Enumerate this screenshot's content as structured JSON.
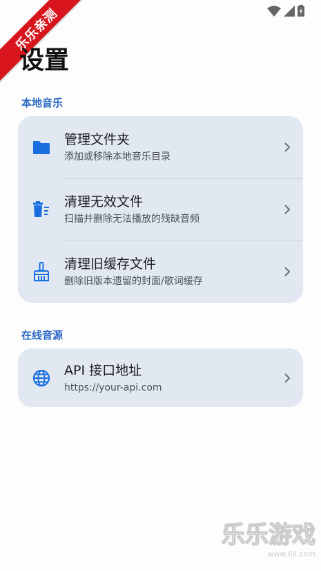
{
  "watermark": {
    "banner_text": "乐乐亲测",
    "bottom_text": "乐乐游戏",
    "bottom_url": "www.6ll.com"
  },
  "page": {
    "title": "设置"
  },
  "sections": [
    {
      "label": "本地音乐",
      "items": [
        {
          "icon": "folder-icon",
          "title": "管理文件夹",
          "subtitle": "添加或移除本地音乐目录"
        },
        {
          "icon": "trash-list-icon",
          "title": "清理无效文件",
          "subtitle": "扫描并删除无法播放的残缺音频"
        },
        {
          "icon": "broom-icon",
          "title": "清理旧缓存文件",
          "subtitle": "删除旧版本遗留的封面/歌词缓存"
        }
      ]
    },
    {
      "label": "在线音源",
      "items": [
        {
          "icon": "globe-icon",
          "title": "API 接口地址",
          "subtitle": "https://your-api.com"
        }
      ]
    }
  ],
  "colors": {
    "accent": "#2a67c4",
    "icon": "#1a6fe0",
    "card_background": "#e1e8f2",
    "banner": "#d8141c"
  }
}
